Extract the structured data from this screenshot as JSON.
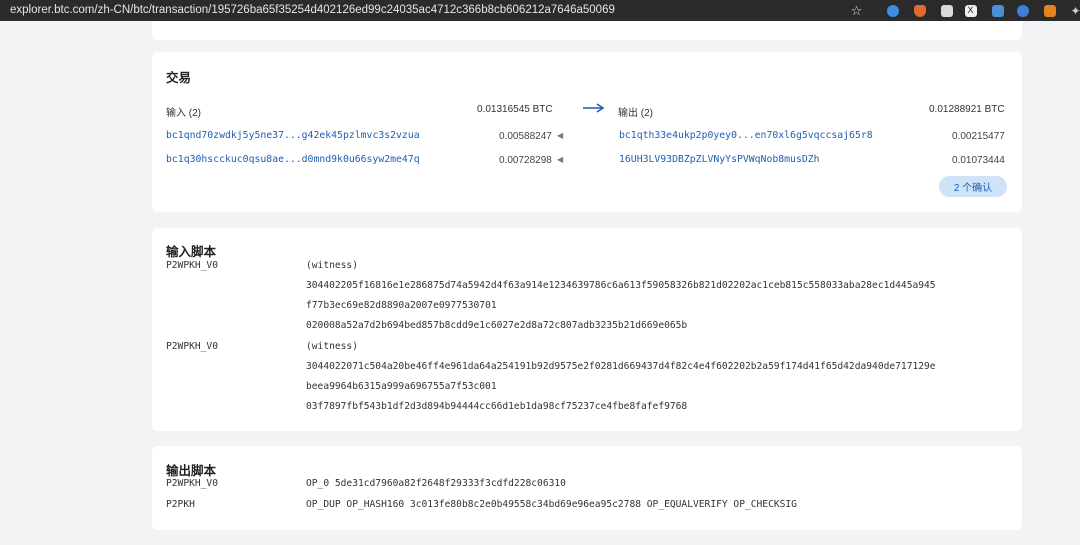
{
  "browser": {
    "url": "explorer.btc.com/zh-CN/btc/transaction/195726ba65f35254d402126ed99c24035ac4712c366b8cb606212a7646a50069"
  },
  "transaction": {
    "title": "交易",
    "inputs_label": "输入 (2)",
    "inputs_total": "0.01316545 BTC",
    "outputs_label": "输出 (2)",
    "outputs_total": "0.01288921 BTC",
    "inputs": [
      {
        "address": "bc1qnd70zwdkj5y5ne37...g42ek45pzlmvc3s2vzua",
        "amount": "0.00588247"
      },
      {
        "address": "bc1q30hscckuc0qsu8ae...d0mnd9k0u66syw2me47q",
        "amount": "0.00728298"
      }
    ],
    "outputs": [
      {
        "address": "bc1qth33e4ukp2p0yey0...en70xl6g5vqccsaj65r8",
        "amount": "0.00215477"
      },
      {
        "address": "16UH3LV93DBZpZLVNyYsPVWqNob8musDZh",
        "amount": "0.01073444"
      }
    ],
    "confirmations": "2 个确认"
  },
  "input_scripts": {
    "title": "输入脚本",
    "items": [
      {
        "type": "P2WPKH_V0",
        "lines": [
          "(witness)",
          "304402205f16816e1e286875d74a5942d4f63a914e1234639786c6a613f59058326b821d02202ac1ceb815c558033aba28ec1d445a945",
          "f77b3ec69e82d8890a2007e0977530701",
          "020008a52a7d2b694bed857b8cdd9e1c6027e2d8a72c807adb3235b21d669e065b"
        ]
      },
      {
        "type": "P2WPKH_V0",
        "lines": [
          "(witness)",
          "3044022071c504a20be46ff4e961da64a254191b92d9575e2f0281d669437d4f82c4e4f602202b2a59f174d41f65d42da940de717129e",
          "beea9964b6315a999a696755a7f53c001",
          "03f7897fbf543b1df2d3d894b94444cc66d1eb1da98cf75237ce4fbe8fafef9768"
        ]
      }
    ]
  },
  "output_scripts": {
    "title": "输出脚本",
    "items": [
      {
        "type": "P2WPKH_V0",
        "script": "OP_0 5de31cd7960a82f2648f29333f3cdfd228c06310"
      },
      {
        "type": "P2PKH",
        "script": "OP_DUP OP_HASH160 3c013fe80b8c2e0b49558c34bd69e96ea95c2788 OP_EQUALVERIFY OP_CHECKSIG"
      }
    ]
  },
  "colors": {
    "link": "#1f5fb4",
    "arrow": "#1f5fb4",
    "badge_bg": "#cfe3f8",
    "page_bg": "#f2f3f5"
  },
  "icons": {
    "bookmark": "star-icon",
    "extensions": [
      "blue-extension-icon",
      "orange-extension-icon",
      "cube-extension-icon",
      "x-extension-icon",
      "grid-extension-icon",
      "shield-extension-icon",
      "fox-extension-icon",
      "puzzle-icon"
    ]
  }
}
